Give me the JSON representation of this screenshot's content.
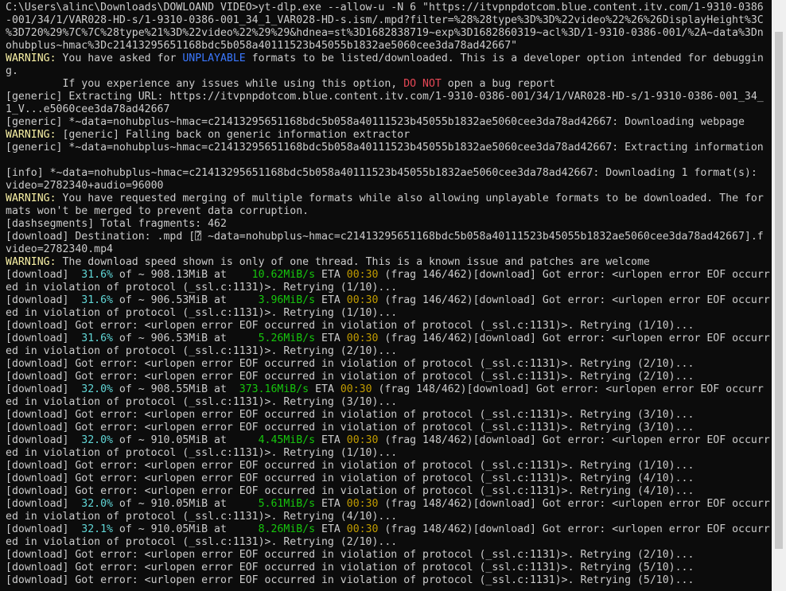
{
  "terminal": {
    "lines": [
      {
        "segments": [
          {
            "t": "C:\\Users\\alinc\\Downloads\\DOWLOAND VIDEO>yt-dlp.exe --allow-u -N 6 \"https://itvpnpdotcom.blue.content.itv.com/1-9310-0386",
            "c": ""
          }
        ]
      },
      {
        "segments": [
          {
            "t": "-001/34/1/VAR028-HD-s/1-9310-0386-001_34_1_VAR028-HD-s.ism/.mpd?filter=%28%28type%3D%3D%22video%22%26%26DisplayHeight%3C",
            "c": ""
          }
        ]
      },
      {
        "segments": [
          {
            "t": "%3D720%29%7C%7C%28type%21%3D%22video%22%29%29&hdnea=st%3D1682838719~exp%3D1682860319~acl%3D/1-9310-0386-001/%2A~data%3Dn",
            "c": ""
          }
        ]
      },
      {
        "segments": [
          {
            "t": "ohubplus~hmac%3Dc21413295651168bdc5b058a40111523b45055b1832ae5060cee3da78ad42667\"",
            "c": ""
          }
        ]
      },
      {
        "segments": [
          {
            "t": "WARNING:",
            "c": "warn"
          },
          {
            "t": " You have asked for ",
            "c": ""
          },
          {
            "t": "UNPLAYABLE",
            "c": "blue"
          },
          {
            "t": " formats to be listed/downloaded. This is a developer option intended for debuggin",
            "c": ""
          }
        ]
      },
      {
        "segments": [
          {
            "t": "g.",
            "c": ""
          }
        ]
      },
      {
        "segments": [
          {
            "t": "         If you experience any issues while using this option, ",
            "c": ""
          },
          {
            "t": "DO NOT",
            "c": "red"
          },
          {
            "t": " open a bug report",
            "c": ""
          }
        ]
      },
      {
        "segments": [
          {
            "t": "[generic] Extracting URL: https://itvpnpdotcom.blue.content.itv.com/1-9310-0386-001/34/1/VAR028-HD-s/1-9310-0386-001_34_",
            "c": ""
          }
        ]
      },
      {
        "segments": [
          {
            "t": "1_V...e5060cee3da78ad42667",
            "c": ""
          }
        ]
      },
      {
        "segments": [
          {
            "t": "[generic] *~data=nohubplus~hmac=c21413295651168bdc5b058a40111523b45055b1832ae5060cee3da78ad42667: Downloading webpage",
            "c": ""
          }
        ]
      },
      {
        "segments": [
          {
            "t": "WARNING:",
            "c": "warn"
          },
          {
            "t": " [generic] Falling back on generic information extractor",
            "c": ""
          }
        ]
      },
      {
        "segments": [
          {
            "t": "[generic] *~data=nohubplus~hmac=c21413295651168bdc5b058a40111523b45055b1832ae5060cee3da78ad42667: Extracting information",
            "c": ""
          }
        ]
      },
      {
        "segments": [
          {
            "t": "",
            "c": ""
          }
        ]
      },
      {
        "segments": [
          {
            "t": "[info] *~data=nohubplus~hmac=c21413295651168bdc5b058a40111523b45055b1832ae5060cee3da78ad42667: Downloading 1 format(s):",
            "c": ""
          }
        ]
      },
      {
        "segments": [
          {
            "t": "video=2782340+audio=96000",
            "c": ""
          }
        ]
      },
      {
        "segments": [
          {
            "t": "WARNING:",
            "c": "warn"
          },
          {
            "t": " You have requested merging of multiple formats while also allowing unplayable formats to be downloaded. The for",
            "c": ""
          }
        ]
      },
      {
        "segments": [
          {
            "t": "mats won't be merged to prevent data corruption.",
            "c": ""
          }
        ]
      },
      {
        "segments": [
          {
            "t": "[dashsegments] Total fragments: 462",
            "c": ""
          }
        ]
      },
      {
        "segments": [
          {
            "t": "[download] Destination: .mpd [⍰ ~data=nohubplus~hmac=c21413295651168bdc5b058a40111523b45055b1832ae5060cee3da78ad42667].f",
            "c": ""
          }
        ]
      },
      {
        "segments": [
          {
            "t": "video=2782340.mp4",
            "c": ""
          }
        ]
      },
      {
        "segments": [
          {
            "t": "WARNING:",
            "c": "warn"
          },
          {
            "t": " The download speed shown is only of one thread. This is a known issue and patches are welcome",
            "c": ""
          }
        ]
      },
      {
        "segments": [
          {
            "t": "[download]  ",
            "c": ""
          },
          {
            "t": "31.6%",
            "c": "cyan"
          },
          {
            "t": " of ~ 908.13MiB at    ",
            "c": ""
          },
          {
            "t": "10.62MiB/s",
            "c": "green"
          },
          {
            "t": " ETA ",
            "c": ""
          },
          {
            "t": "00:30",
            "c": "yellow"
          },
          {
            "t": " (frag 146/462)[download] Got error: <urlopen error EOF occurr",
            "c": ""
          }
        ]
      },
      {
        "segments": [
          {
            "t": "ed in violation of protocol (_ssl.c:1131)>. Retrying (1/10)...",
            "c": ""
          }
        ]
      },
      {
        "segments": [
          {
            "t": "[download]  ",
            "c": ""
          },
          {
            "t": "31.6%",
            "c": "cyan"
          },
          {
            "t": " of ~ 906.53MiB at     ",
            "c": ""
          },
          {
            "t": "3.96MiB/s",
            "c": "green"
          },
          {
            "t": " ETA ",
            "c": ""
          },
          {
            "t": "00:30",
            "c": "yellow"
          },
          {
            "t": " (frag 146/462)[download] Got error: <urlopen error EOF occurr",
            "c": ""
          }
        ]
      },
      {
        "segments": [
          {
            "t": "ed in violation of protocol (_ssl.c:1131)>. Retrying (1/10)...",
            "c": ""
          }
        ]
      },
      {
        "segments": [
          {
            "t": "[download] Got error: <urlopen error EOF occurred in violation of protocol (_ssl.c:1131)>. Retrying (1/10)...",
            "c": ""
          }
        ]
      },
      {
        "segments": [
          {
            "t": "[download]  ",
            "c": ""
          },
          {
            "t": "31.6%",
            "c": "cyan"
          },
          {
            "t": " of ~ 906.53MiB at     ",
            "c": ""
          },
          {
            "t": "5.26MiB/s",
            "c": "green"
          },
          {
            "t": " ETA ",
            "c": ""
          },
          {
            "t": "00:30",
            "c": "yellow"
          },
          {
            "t": " (frag 146/462)[download] Got error: <urlopen error EOF occurr",
            "c": ""
          }
        ]
      },
      {
        "segments": [
          {
            "t": "ed in violation of protocol (_ssl.c:1131)>. Retrying (2/10)...",
            "c": ""
          }
        ]
      },
      {
        "segments": [
          {
            "t": "[download] Got error: <urlopen error EOF occurred in violation of protocol (_ssl.c:1131)>. Retrying (2/10)...",
            "c": ""
          }
        ]
      },
      {
        "segments": [
          {
            "t": "[download] Got error: <urlopen error EOF occurred in violation of protocol (_ssl.c:1131)>. Retrying (2/10)...",
            "c": ""
          }
        ]
      },
      {
        "segments": [
          {
            "t": "[download]  ",
            "c": ""
          },
          {
            "t": "32.0%",
            "c": "cyan"
          },
          {
            "t": " of ~ 908.55MiB at  ",
            "c": ""
          },
          {
            "t": "373.16MiB/s",
            "c": "green"
          },
          {
            "t": " ETA ",
            "c": ""
          },
          {
            "t": "00:30",
            "c": "yellow"
          },
          {
            "t": " (frag 148/462)[download] Got error: <urlopen error EOF occurr",
            "c": ""
          }
        ]
      },
      {
        "segments": [
          {
            "t": "ed in violation of protocol (_ssl.c:1131)>. Retrying (3/10)...",
            "c": ""
          }
        ]
      },
      {
        "segments": [
          {
            "t": "[download] Got error: <urlopen error EOF occurred in violation of protocol (_ssl.c:1131)>. Retrying (3/10)...",
            "c": ""
          }
        ]
      },
      {
        "segments": [
          {
            "t": "[download] Got error: <urlopen error EOF occurred in violation of protocol (_ssl.c:1131)>. Retrying (3/10)...",
            "c": ""
          }
        ]
      },
      {
        "segments": [
          {
            "t": "[download]  ",
            "c": ""
          },
          {
            "t": "32.0%",
            "c": "cyan"
          },
          {
            "t": " of ~ 910.05MiB at     ",
            "c": ""
          },
          {
            "t": "4.45MiB/s",
            "c": "green"
          },
          {
            "t": " ETA ",
            "c": ""
          },
          {
            "t": "00:30",
            "c": "yellow"
          },
          {
            "t": " (frag 148/462)[download] Got error: <urlopen error EOF occurr",
            "c": ""
          }
        ]
      },
      {
        "segments": [
          {
            "t": "ed in violation of protocol (_ssl.c:1131)>. Retrying (1/10)...",
            "c": ""
          }
        ]
      },
      {
        "segments": [
          {
            "t": "[download] Got error: <urlopen error EOF occurred in violation of protocol (_ssl.c:1131)>. Retrying (1/10)...",
            "c": ""
          }
        ]
      },
      {
        "segments": [
          {
            "t": "[download] Got error: <urlopen error EOF occurred in violation of protocol (_ssl.c:1131)>. Retrying (4/10)...",
            "c": ""
          }
        ]
      },
      {
        "segments": [
          {
            "t": "[download] Got error: <urlopen error EOF occurred in violation of protocol (_ssl.c:1131)>. Retrying (4/10)...",
            "c": ""
          }
        ]
      },
      {
        "segments": [
          {
            "t": "[download]  ",
            "c": ""
          },
          {
            "t": "32.0%",
            "c": "cyan"
          },
          {
            "t": " of ~ 910.05MiB at     ",
            "c": ""
          },
          {
            "t": "5.61MiB/s",
            "c": "green"
          },
          {
            "t": " ETA ",
            "c": ""
          },
          {
            "t": "00:30",
            "c": "yellow"
          },
          {
            "t": " (frag 148/462)[download] Got error: <urlopen error EOF occurr",
            "c": ""
          }
        ]
      },
      {
        "segments": [
          {
            "t": "ed in violation of protocol (_ssl.c:1131)>. Retrying (4/10)...",
            "c": ""
          }
        ]
      },
      {
        "segments": [
          {
            "t": "[download]  ",
            "c": ""
          },
          {
            "t": "32.1%",
            "c": "cyan"
          },
          {
            "t": " of ~ 910.05MiB at     ",
            "c": ""
          },
          {
            "t": "8.26MiB/s",
            "c": "green"
          },
          {
            "t": " ETA ",
            "c": ""
          },
          {
            "t": "00:30",
            "c": "yellow"
          },
          {
            "t": " (frag 148/462)[download] Got error: <urlopen error EOF occurr",
            "c": ""
          }
        ]
      },
      {
        "segments": [
          {
            "t": "ed in violation of protocol (_ssl.c:1131)>. Retrying (2/10)...",
            "c": ""
          }
        ]
      },
      {
        "segments": [
          {
            "t": "[download] Got error: <urlopen error EOF occurred in violation of protocol (_ssl.c:1131)>. Retrying (2/10)...",
            "c": ""
          }
        ]
      },
      {
        "segments": [
          {
            "t": "[download] Got error: <urlopen error EOF occurred in violation of protocol (_ssl.c:1131)>. Retrying (5/10)...",
            "c": ""
          }
        ]
      },
      {
        "segments": [
          {
            "t": "[download] Got error: <urlopen error EOF occurred in violation of protocol (_ssl.c:1131)>. Retrying (5/10)...",
            "c": ""
          }
        ]
      }
    ]
  },
  "colors": {
    "background": "#0c0c0c",
    "text": "#cccccc",
    "warning": "#f9f1a5",
    "percent": "#61d6d6",
    "speed": "#16c60c",
    "eta": "#c19c00",
    "donot": "#e74856",
    "unplayable": "#3b78ff"
  }
}
